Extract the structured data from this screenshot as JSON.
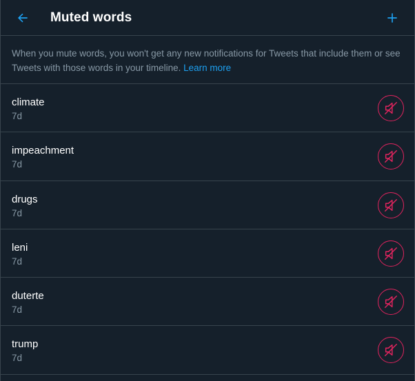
{
  "header": {
    "title": "Muted words",
    "back_icon": "arrow-left-icon",
    "add_icon": "plus-icon"
  },
  "description": {
    "text": "When you mute words, you won't get any new notifications for Tweets that include them or see Tweets with those words in your timeline.",
    "link": "Learn more"
  },
  "colors": {
    "background": "#15202b",
    "accent": "#1da1f2",
    "mute_red": "#e0245e",
    "secondary_text": "#8899a6",
    "border": "#38444d"
  },
  "muted_words": [
    {
      "word": "climate",
      "age": "7d",
      "icon": "muted-speaker-icon"
    },
    {
      "word": "impeachment",
      "age": "7d",
      "icon": "muted-speaker-icon"
    },
    {
      "word": "drugs",
      "age": "7d",
      "icon": "muted-speaker-icon"
    },
    {
      "word": "leni",
      "age": "7d",
      "icon": "muted-speaker-icon"
    },
    {
      "word": "duterte",
      "age": "7d",
      "icon": "muted-speaker-icon"
    },
    {
      "word": "trump",
      "age": "7d",
      "icon": "muted-speaker-icon"
    }
  ]
}
